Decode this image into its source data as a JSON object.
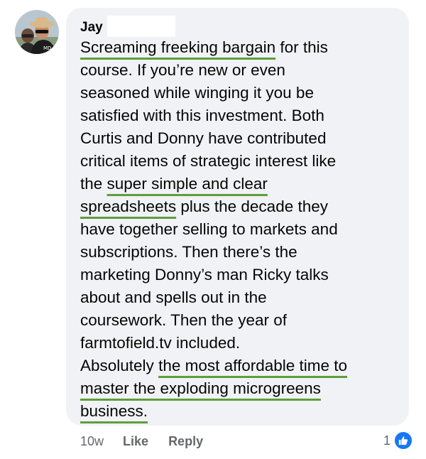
{
  "comment": {
    "author": "Jay",
    "lines": [
      [
        {
          "t": "Screaming freeking bargain",
          "u": true
        },
        {
          "t": " for this",
          "u": false
        }
      ],
      [
        {
          "t": "course. If you’re new or even",
          "u": false
        }
      ],
      [
        {
          "t": "seasoned while winging it you be",
          "u": false
        }
      ],
      [
        {
          "t": "satisfied with this investment. Both",
          "u": false
        }
      ],
      [
        {
          "t": "Curtis and Donny have contributed",
          "u": false
        }
      ],
      [
        {
          "t": "critical items of strategic interest like",
          "u": false
        }
      ],
      [
        {
          "t": "the ",
          "u": false
        },
        {
          "t": "super simple and clear",
          "u": true
        }
      ],
      [
        {
          "t": "spreadsheets",
          "u": true
        },
        {
          "t": " plus the decade they",
          "u": false
        }
      ],
      [
        {
          "t": "have together selling to markets and",
          "u": false
        }
      ],
      [
        {
          "t": "subscriptions. Then there’s the",
          "u": false
        }
      ],
      [
        {
          "t": "marketing Donny’s man Ricky talks",
          "u": false
        }
      ],
      [
        {
          "t": "about and spells out in the",
          "u": false
        }
      ],
      [
        {
          "t": "coursework. Then the year of",
          "u": false
        }
      ],
      [
        {
          "t": "farmtofield.tv included.",
          "u": false
        }
      ],
      [
        {
          "t": "Absolutely ",
          "u": false
        },
        {
          "t": "the most affordable time to",
          "u": true
        }
      ],
      [
        {
          "t": "master the exploding microgreens",
          "u": true
        }
      ],
      [
        {
          "t": "business.",
          "u": true
        }
      ]
    ],
    "underline_color": "#5e9e3a",
    "bubble_color": "#f0f2f5"
  },
  "actions": {
    "time": "10w",
    "like_label": "Like",
    "reply_label": "Reply"
  },
  "reactions": {
    "count": "1",
    "icon": "thumbs-up-icon",
    "color": "#1877f2"
  }
}
